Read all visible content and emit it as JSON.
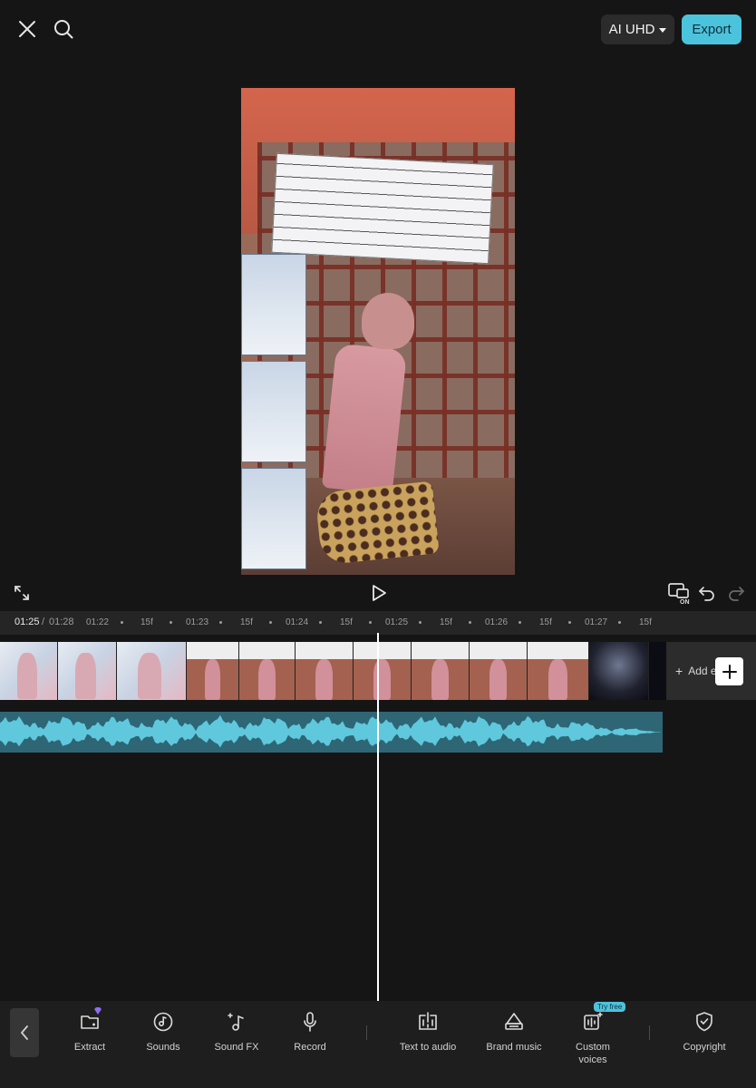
{
  "header": {
    "quality_label": "AI UHD",
    "export_label": "Export"
  },
  "timeline": {
    "current_time": "01:25",
    "separator": "/",
    "total_time": "01:28",
    "ruler_labels": [
      "01:22",
      "15f",
      "01:23",
      "15f",
      "01:24",
      "15f",
      "01:25",
      "15f",
      "01:26",
      "15f",
      "01:27",
      "15f"
    ],
    "add_ending_label": "Add e"
  },
  "toolbar": {
    "tools": [
      {
        "label": "Extract",
        "icon": "folder-icon"
      },
      {
        "label": "Sounds",
        "icon": "music-disc-icon"
      },
      {
        "label": "Sound FX",
        "icon": "music-sparkle-icon"
      },
      {
        "label": "Record",
        "icon": "microphone-icon"
      },
      {
        "label": "Text to audio",
        "icon": "text-to-audio-icon"
      },
      {
        "label": "Brand music",
        "icon": "brand-music-icon"
      },
      {
        "label": "Custom voices",
        "label_line1": "Custom",
        "label_line2": "voices",
        "icon": "custom-voices-icon",
        "badge": "Try free"
      },
      {
        "label": "Copyright",
        "icon": "shield-check-icon"
      }
    ]
  },
  "colors": {
    "accent": "#4cc3dd",
    "background": "#151515",
    "audio_track": "#2e6675",
    "waveform": "#5fc8dc"
  }
}
